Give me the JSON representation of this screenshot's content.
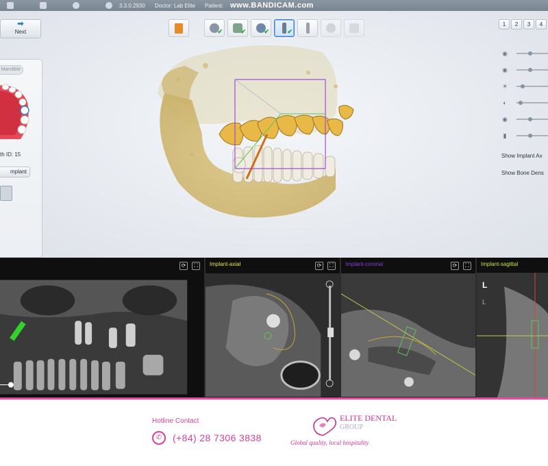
{
  "titlebar": {
    "version": "3.3.0.2930",
    "doctor": "Doctor: Lab Elite",
    "patient": "Patient:",
    "watermark": "www.BANDICAM.com"
  },
  "nav": {
    "next_label": "Next"
  },
  "left_panel": {
    "tab_label": "Mandible",
    "tooth_id": "th ID: 15",
    "implant_label": "mplant"
  },
  "toolbar": {
    "steps": [
      {
        "icon": "report-icon",
        "active": false,
        "checked": false
      },
      {
        "icon": "scan-icon",
        "active": false,
        "checked": true
      },
      {
        "icon": "jaw-icon",
        "active": false,
        "checked": true
      },
      {
        "icon": "eye-icon",
        "active": false,
        "checked": true
      },
      {
        "icon": "implant-icon",
        "active": true,
        "checked": true
      },
      {
        "icon": "abutment-icon",
        "active": false,
        "checked": false
      },
      {
        "icon": "crown-icon",
        "active": false,
        "checked": false
      },
      {
        "icon": "document-icon",
        "active": false,
        "checked": false
      }
    ]
  },
  "right_panel": {
    "tabs": [
      "1",
      "2",
      "3",
      "4"
    ],
    "sliders": [
      {
        "icon": "visibility-icon",
        "level": 0.3
      },
      {
        "icon": "visibility-icon",
        "level": 0.3
      },
      {
        "icon": "brightness-icon",
        "level": 0.1
      },
      {
        "icon": "contrast-icon",
        "level": 0.05
      },
      {
        "icon": "visibility-icon",
        "level": 0.3
      },
      {
        "icon": "implant-icon",
        "level": 0.3
      }
    ],
    "show_implant_axis": "Show Implant Ax",
    "show_bone_density": "Show Bone Dens"
  },
  "ct_views": {
    "axial_title": "Implant-axial",
    "coronal_title": "Implant-coronal",
    "sagittal_title": "Implant-sagittal",
    "colors": {
      "axial": "#e3e34a",
      "coronal": "#8a3ce0",
      "sagittal": "#c8e43a"
    }
  },
  "footer": {
    "hotline_label": "Hotline Contact",
    "phone": "(+84) 28 7306 3838",
    "brand_line1": "ELITE DENTAL",
    "brand_line2": "GROUP",
    "tagline": "Global quality, local hospitality"
  }
}
